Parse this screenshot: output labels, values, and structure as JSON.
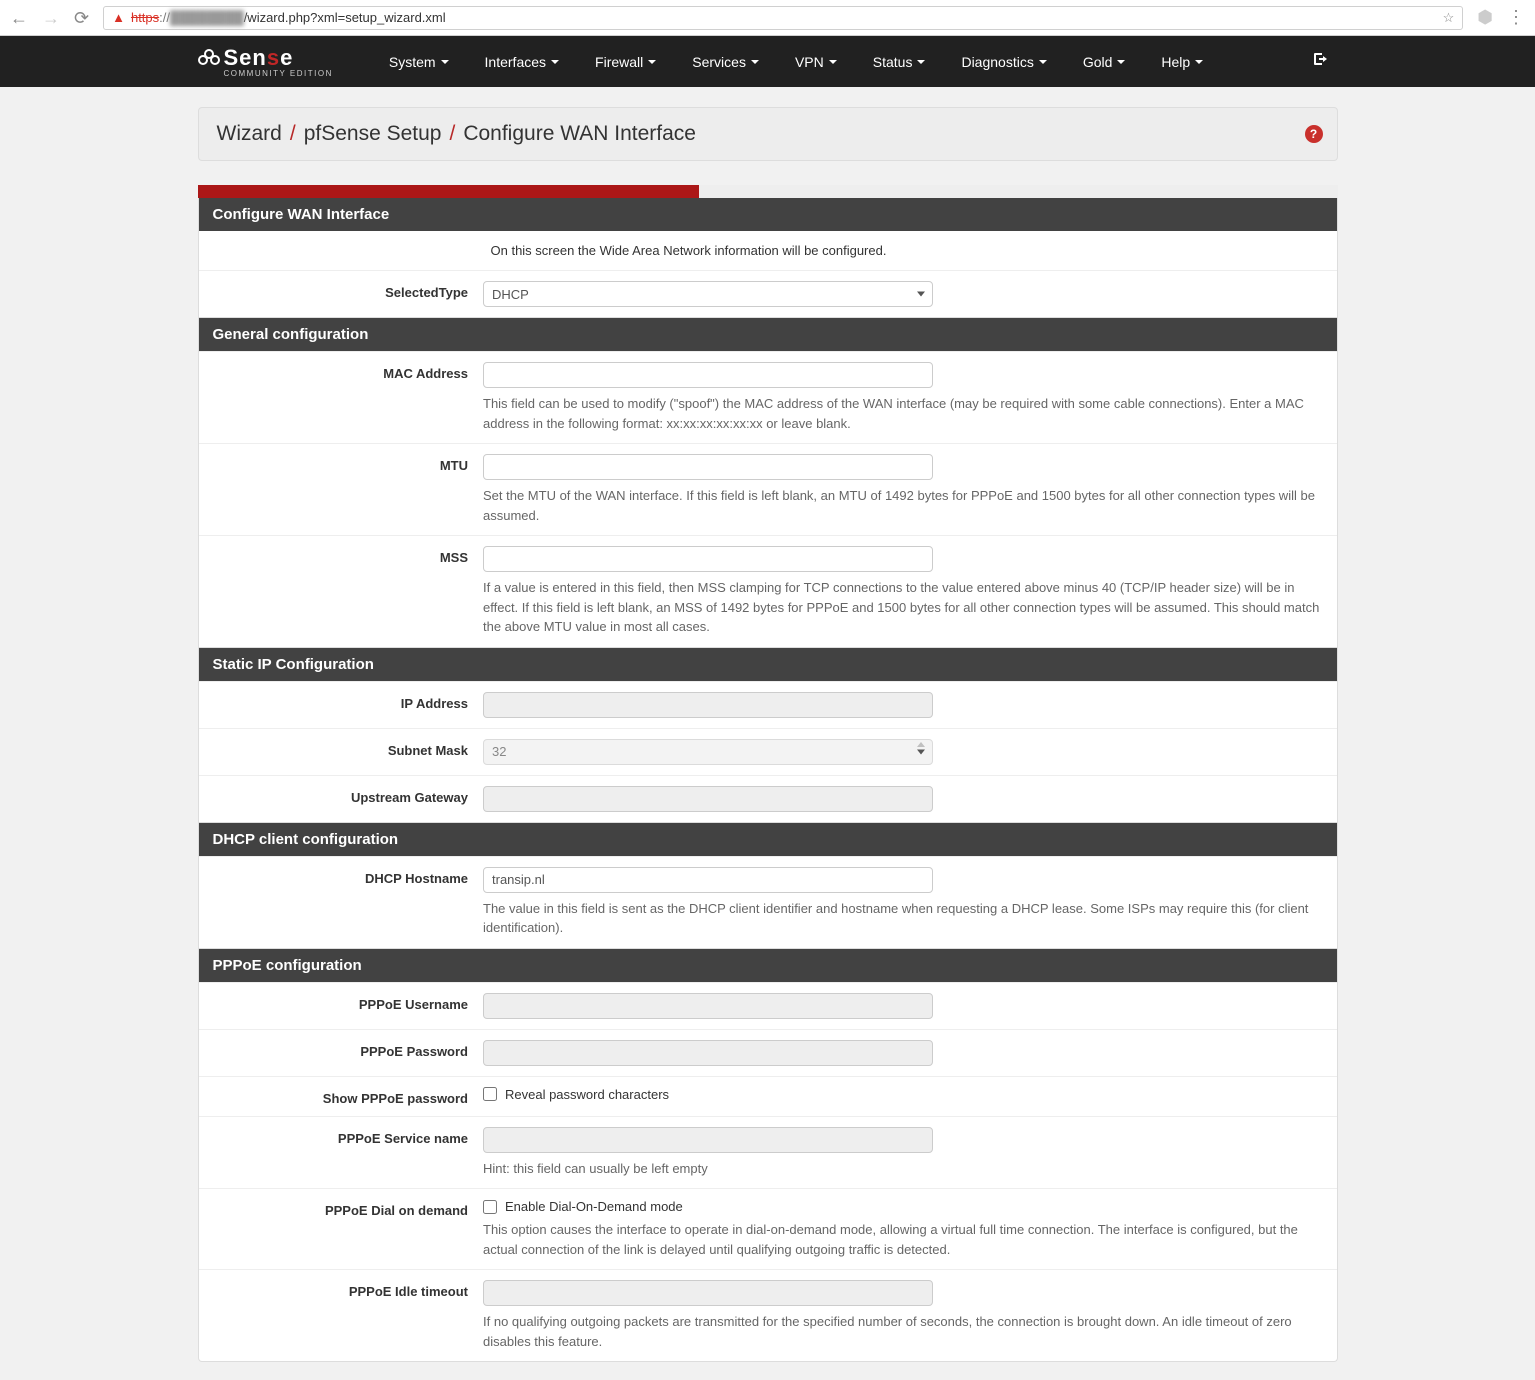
{
  "browser": {
    "url_proto": "https",
    "url_host_blur": "████████",
    "url_path": "/wizard.php?xml=setup_wizard.xml"
  },
  "nav": {
    "brand_main": "Sen",
    "brand_red": "s",
    "brand_end": "e",
    "brand_sub": "COMMUNITY EDITION",
    "items": [
      "System",
      "Interfaces",
      "Firewall",
      "Services",
      "VPN",
      "Status",
      "Diagnostics",
      "Gold",
      "Help"
    ]
  },
  "breadcrumb": {
    "a": "Wizard",
    "b": "pfSense Setup",
    "c": "Configure WAN Interface"
  },
  "progress_percent": 44,
  "panels": {
    "configure": {
      "title": "Configure WAN Interface",
      "intro": "On this screen the Wide Area Network information will be configured.",
      "selected_type_label": "SelectedType",
      "selected_type_value": "DHCP"
    },
    "general": {
      "title": "General configuration",
      "mac_label": "MAC Address",
      "mac_help": "This field can be used to modify (\"spoof\") the MAC address of the WAN interface (may be required with some cable connections). Enter a MAC address in the following format: xx:xx:xx:xx:xx:xx or leave blank.",
      "mtu_label": "MTU",
      "mtu_help": "Set the MTU of the WAN interface. If this field is left blank, an MTU of 1492 bytes for PPPoE and 1500 bytes for all other connection types will be assumed.",
      "mss_label": "MSS",
      "mss_help": "If a value is entered in this field, then MSS clamping for TCP connections to the value entered above minus 40 (TCP/IP header size) will be in effect. If this field is left blank, an MSS of 1492 bytes for PPPoE and 1500 bytes for all other connection types will be assumed. This should match the above MTU value in most all cases."
    },
    "static": {
      "title": "Static IP Configuration",
      "ip_label": "IP Address",
      "subnet_label": "Subnet Mask",
      "subnet_value": "32",
      "gw_label": "Upstream Gateway"
    },
    "dhcp": {
      "title": "DHCP client configuration",
      "host_label": "DHCP Hostname",
      "host_value": "transip.nl",
      "host_help": "The value in this field is sent as the DHCP client identifier and hostname when requesting a DHCP lease. Some ISPs may require this (for client identification)."
    },
    "pppoe": {
      "title": "PPPoE configuration",
      "user_label": "PPPoE Username",
      "pass_label": "PPPoE Password",
      "showpass_label": "Show PPPoE password",
      "showpass_text": "Reveal password characters",
      "service_label": "PPPoE Service name",
      "service_help": "Hint: this field can usually be left empty",
      "dod_label": "PPPoE Dial on demand",
      "dod_text": "Enable Dial-On-Demand mode",
      "dod_help": "This option causes the interface to operate in dial-on-demand mode, allowing a virtual full time connection. The interface is configured, but the actual connection of the link is delayed until qualifying outgoing traffic is detected.",
      "idle_label": "PPPoE Idle timeout",
      "idle_help": "If no qualifying outgoing packets are transmitted for the specified number of seconds, the connection is brought down. An idle timeout of zero disables this feature."
    }
  }
}
